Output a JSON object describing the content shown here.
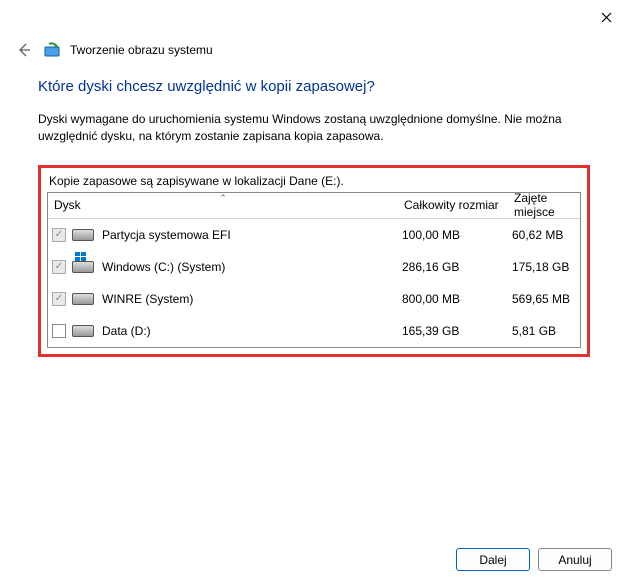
{
  "window": {
    "title": "Tworzenie obrazu systemu"
  },
  "heading": "Które dyski chcesz uwzględnić w kopii zapasowej?",
  "description": "Dyski wymagane do uruchomienia systemu Windows zostaną uwzględnione domyślne. Nie można uwzględnić dysku, na którym zostanie zapisana kopia zapasowa.",
  "backup_location_line": "Kopie zapasowe są zapisywane w lokalizacji Dane (E:).",
  "columns": {
    "disk": "Dysk",
    "total": "Całkowity rozmiar",
    "used": "Zajęte miejsce"
  },
  "rows": [
    {
      "checked": true,
      "locked": true,
      "win": false,
      "name": "Partycja systemowa EFI",
      "total": "100,00 MB",
      "used": "60,62 MB"
    },
    {
      "checked": true,
      "locked": true,
      "win": true,
      "name": "Windows (C:) (System)",
      "total": "286,16 GB",
      "used": "175,18 GB"
    },
    {
      "checked": true,
      "locked": true,
      "win": false,
      "name": "WINRE (System)",
      "total": "800,00 MB",
      "used": "569,65 MB"
    },
    {
      "checked": false,
      "locked": false,
      "win": false,
      "name": "Data (D:)",
      "total": "165,39 GB",
      "used": "5,81 GB"
    }
  ],
  "buttons": {
    "next": "Dalej",
    "cancel": "Anuluj"
  }
}
